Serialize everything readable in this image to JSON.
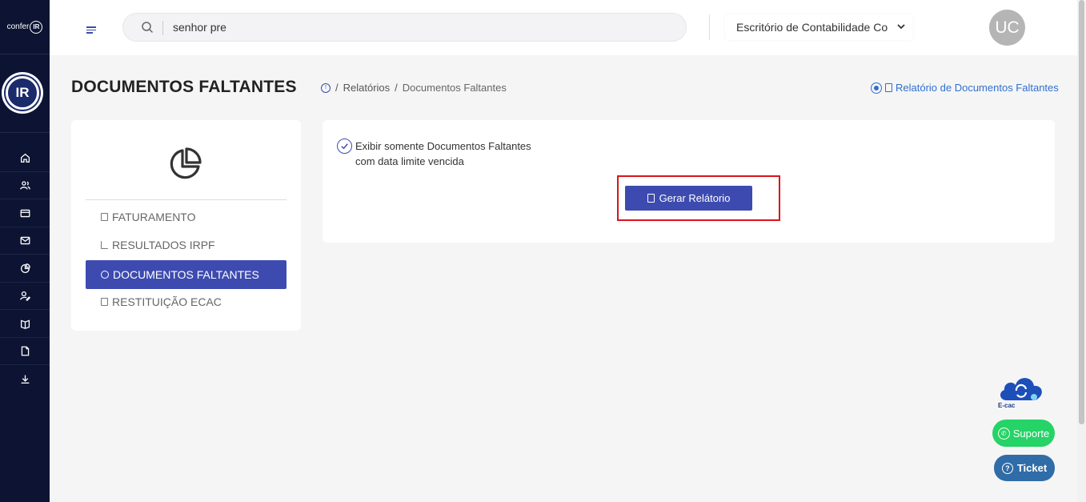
{
  "app": {
    "logo_small_text": "confer",
    "logo_small_mark": "IR",
    "logo_big_mark": "IR"
  },
  "sidebar": {
    "icons": [
      "home-icon",
      "users-icon",
      "card-icon",
      "mail-icon",
      "chart-pie-icon",
      "user-edit-icon",
      "book-icon",
      "file-icon",
      "download-icon"
    ]
  },
  "topbar": {
    "search_value": "senhor pre",
    "office_select": "Escritório de Contabilidade Co",
    "avatar_initials": "UC"
  },
  "page": {
    "title": "DOCUMENTOS FALTANTES",
    "breadcrumb": [
      "Relatórios",
      "Documentos Faltantes"
    ],
    "breadcrumb_sep": "/",
    "report_link": "Relatório de Documentos Faltantes"
  },
  "left_menu": {
    "items": [
      {
        "label": "FATURAMENTO",
        "active": false
      },
      {
        "label": "RESULTADOS IRPF",
        "active": false
      },
      {
        "label": "DOCUMENTOS FALTANTES",
        "active": true
      },
      {
        "label": "RESTITUIÇÃO ECAC",
        "active": false
      }
    ]
  },
  "main": {
    "checkbox_label": "Exibir somente Documentos Faltantes com data limite vencida",
    "checkbox_checked": true,
    "generate_button": "Gerar Relátorio"
  },
  "widgets": {
    "ecac_label": "E-cac",
    "suporte_label": "Suporte",
    "ticket_label": "Ticket"
  },
  "colors": {
    "sidebar": "#0d1433",
    "primary": "#3d4bb0",
    "highlight": "#d9141a",
    "whatsapp": "#25d366",
    "ticket": "#2f6ca8",
    "link": "#2f6fd0"
  }
}
